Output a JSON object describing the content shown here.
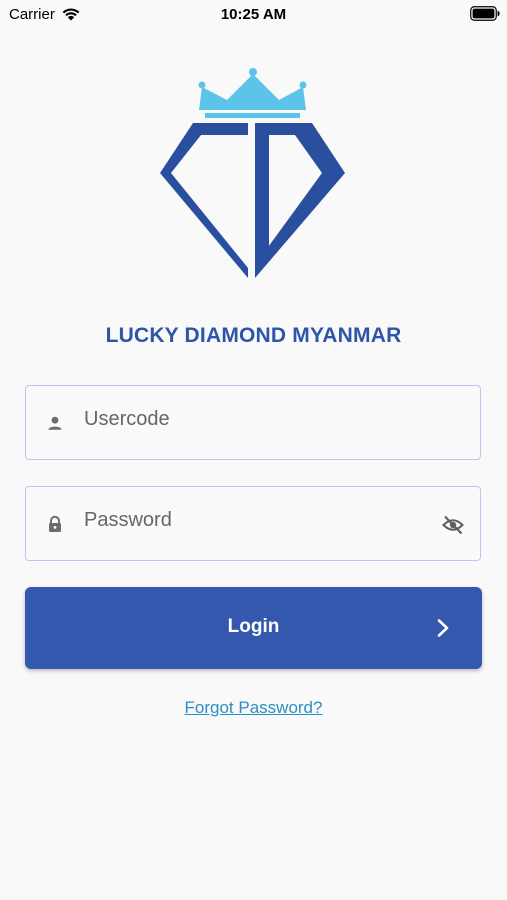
{
  "status_bar": {
    "carrier": "Carrier",
    "time": "10:25 AM"
  },
  "brand": {
    "title": "LUCKY DIAMOND MYANMAR",
    "logo_colors": {
      "crown": "#5bc4e8",
      "diamond": "#2a4f9f"
    }
  },
  "form": {
    "usercode": {
      "placeholder": "Usercode",
      "value": "",
      "icon": "person-icon"
    },
    "password": {
      "placeholder": "Password",
      "value": "",
      "icon": "lock-icon",
      "toggle_icon": "eye-off-icon"
    },
    "login_label": "Login",
    "login_icon": "chevron-right-icon",
    "forgot_label": "Forgot Password?"
  },
  "colors": {
    "primary": "#3358ae",
    "field_border": "#b9c9ee",
    "link": "#2b8fc2",
    "background": "#f9f9f9"
  }
}
